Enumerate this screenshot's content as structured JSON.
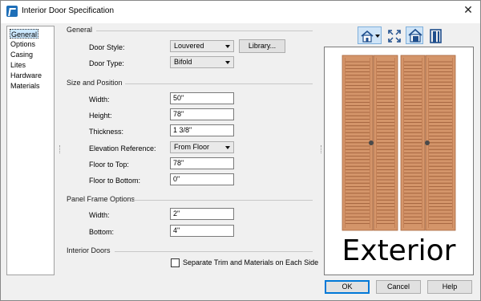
{
  "window": {
    "title": "Interior Door Specification",
    "close_glyph": "✕"
  },
  "nav": {
    "items": [
      "General",
      "Options",
      "Casing",
      "Lites",
      "Hardware",
      "Materials"
    ]
  },
  "general": {
    "heading": "General",
    "door_style": {
      "label": "Door Style:",
      "value": "Louvered"
    },
    "library_button": "Library...",
    "door_type": {
      "label": "Door Type:",
      "value": "Bifold"
    }
  },
  "size": {
    "heading": "Size and Position",
    "width": {
      "label": "Width:",
      "value": "50\""
    },
    "height": {
      "label": "Height:",
      "value": "78\""
    },
    "thickness": {
      "label": "Thickness:",
      "value": "1 3/8\""
    },
    "elevation": {
      "label": "Elevation Reference:",
      "value": "From Floor"
    },
    "floor_top": {
      "label": "Floor to Top:",
      "value": "78\""
    },
    "floor_bottom": {
      "label": "Floor to Bottom:",
      "value": "0\""
    }
  },
  "panel_frame": {
    "heading": "Panel Frame Options",
    "width": {
      "label": "Width:",
      "value": "2\""
    },
    "bottom": {
      "label": "Bottom:",
      "value": "4\""
    }
  },
  "interior": {
    "heading": "Interior Doors",
    "separate_trim": {
      "label": "Separate Trim and Materials on Each Side",
      "checked": false
    }
  },
  "toolbar": {
    "icons": [
      "camera-view-icon",
      "fill-window-icon",
      "color-view-icon",
      "door-preview-icon"
    ]
  },
  "preview": {
    "label": "Exterior",
    "door_color": "#d4956a"
  },
  "buttons": {
    "ok": "OK",
    "cancel": "Cancel",
    "help": "Help"
  },
  "colors": {
    "accent": "#0078d7",
    "selection": "#cce8ff"
  }
}
